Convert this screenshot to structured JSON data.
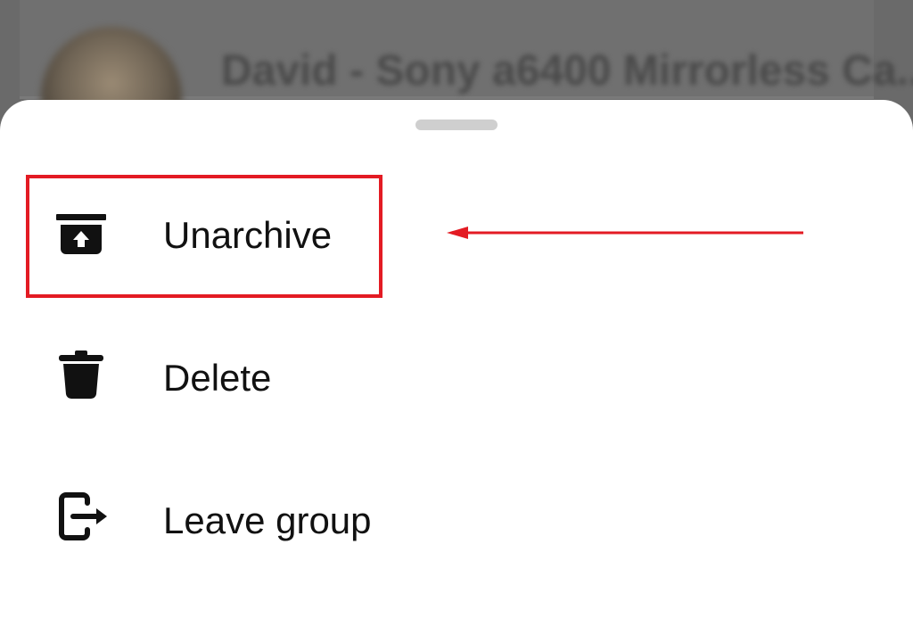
{
  "background": {
    "chat_title": "David - Sony a6400 Mirrorless Ca..."
  },
  "sheet": {
    "items": [
      {
        "label": "Unarchive",
        "icon": "unarchive-icon"
      },
      {
        "label": "Delete",
        "icon": "trash-icon"
      },
      {
        "label": "Leave group",
        "icon": "leave-icon"
      }
    ]
  },
  "annotation": {
    "color": "#e31b23",
    "highlighted_item": "Unarchive"
  }
}
